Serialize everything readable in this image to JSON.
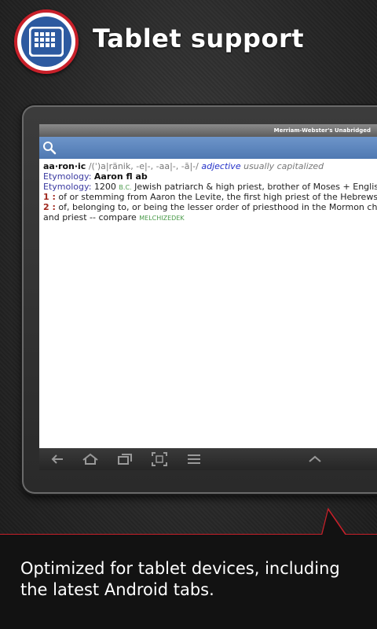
{
  "header": {
    "title": "Tablet support",
    "icon": "tablet-grid-icon"
  },
  "app": {
    "title": "Merriam-Webster's Unabridged",
    "search_icon": "search-icon",
    "entry": {
      "headword": "aa·ron·ic",
      "pronunciation": "/(ˈ)a|ränik, -e|-, -aa|-, -ā|-/",
      "part_of_speech": "adjective",
      "usage": "usually capitalized",
      "etymology_label_1": "Etymology",
      "etymology_1": "Aaron fl ab",
      "etymology_label_2": "Etymology",
      "etymology_2_year": "1200",
      "etymology_2_era": "B.C.",
      "etymology_2_text": "Jewish patriarch & high priest, brother of Moses + English",
      "sense_1_num": "1 :",
      "sense_1_text": "of or stemming from Aaron the Levite, the first high priest of the Hebrews",
      "sense_2_num": "2 :",
      "sense_2_text": "of, belonging to, or being the lesser order of priesthood in the Mormon church",
      "sense_2_cont": "and priest -- compare",
      "xref": "MELCHIZEDEK"
    }
  },
  "navbar": {
    "buttons": [
      "back-icon",
      "home-icon",
      "recent-apps-icon",
      "screenshot-icon",
      "menu-icon",
      "chevron-up-icon"
    ]
  },
  "footer": {
    "text": "Optimized for tablet devices, including the latest Android tabs."
  },
  "colors": {
    "accent_red": "#c8202a",
    "brand_blue": "#2d5aa0",
    "toolbar_blue": "#5b84bc"
  }
}
